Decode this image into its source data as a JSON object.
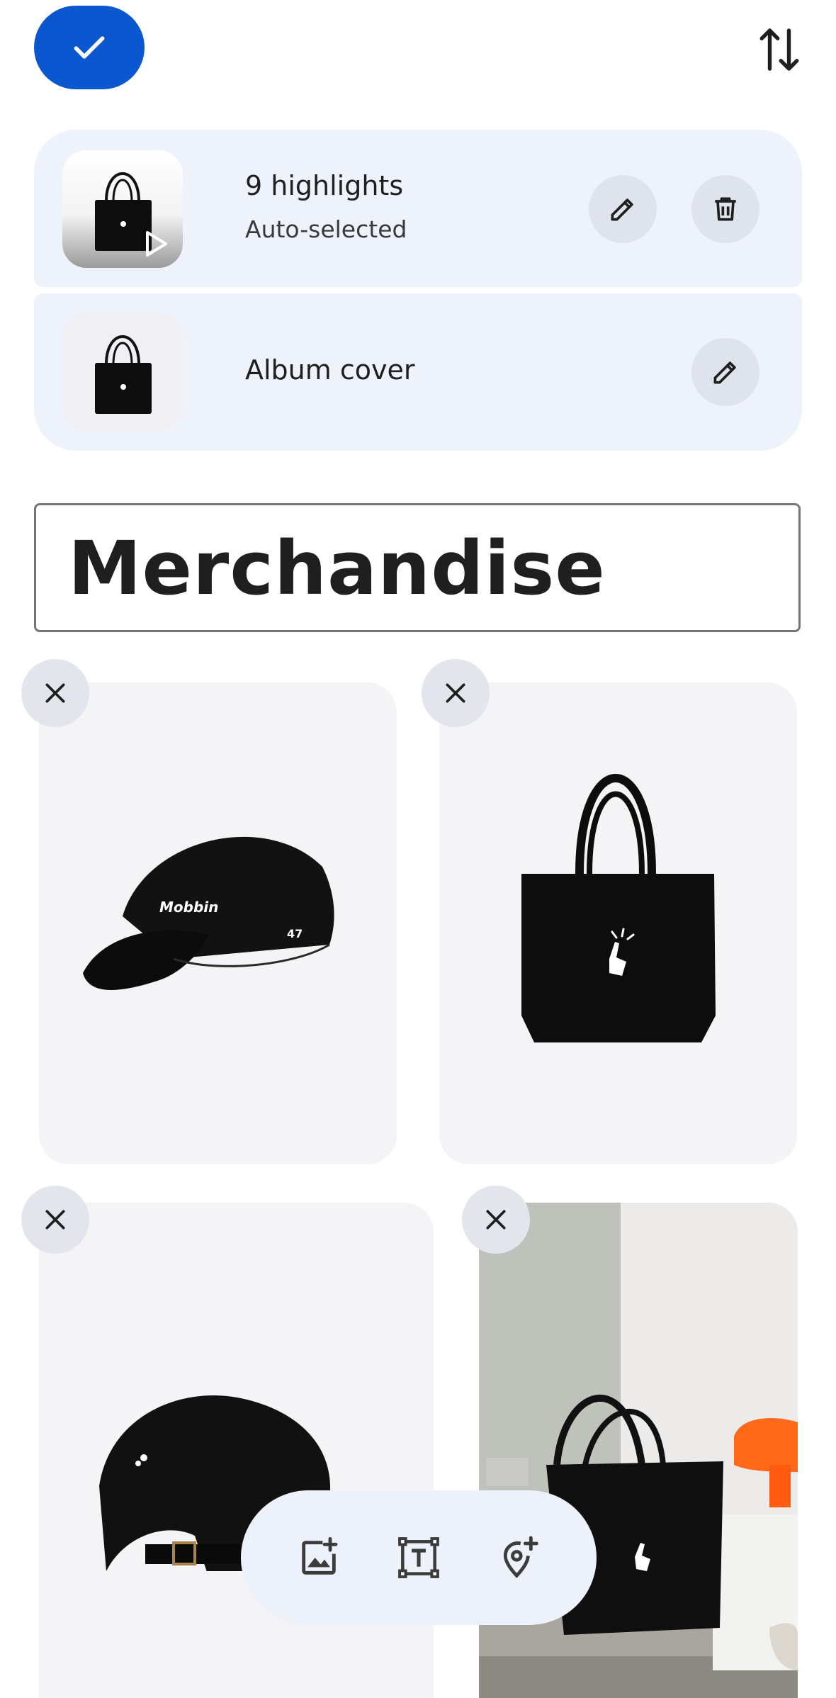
{
  "top_bar": {
    "done_icon": "check-icon",
    "sort_icon": "swap-vertical-icon",
    "accent_color": "#0b57d0"
  },
  "highlights_card": {
    "title": "9 highlights",
    "subtitle": "Auto-selected",
    "thumbnail": "tote-bag-with-play",
    "actions": [
      "edit-icon",
      "delete-icon"
    ]
  },
  "album_cover_card": {
    "title": "Album cover",
    "thumbnail": "tote-bag",
    "actions": [
      "edit-icon"
    ]
  },
  "section_title": {
    "value": "Merchandise"
  },
  "items": [
    {
      "image": "black-cap-front",
      "cap_text": "Mobbin",
      "badge": "47",
      "remove_icon": "close-icon"
    },
    {
      "image": "black-tote-bag",
      "remove_icon": "close-icon"
    },
    {
      "image": "black-cap-back",
      "remove_icon": "close-icon"
    },
    {
      "image": "tote-bag-lifestyle-photo",
      "remove_icon": "close-icon"
    }
  ],
  "toolbar": {
    "tools": [
      "add-photo-icon",
      "text-box-icon",
      "add-location-icon"
    ]
  }
}
